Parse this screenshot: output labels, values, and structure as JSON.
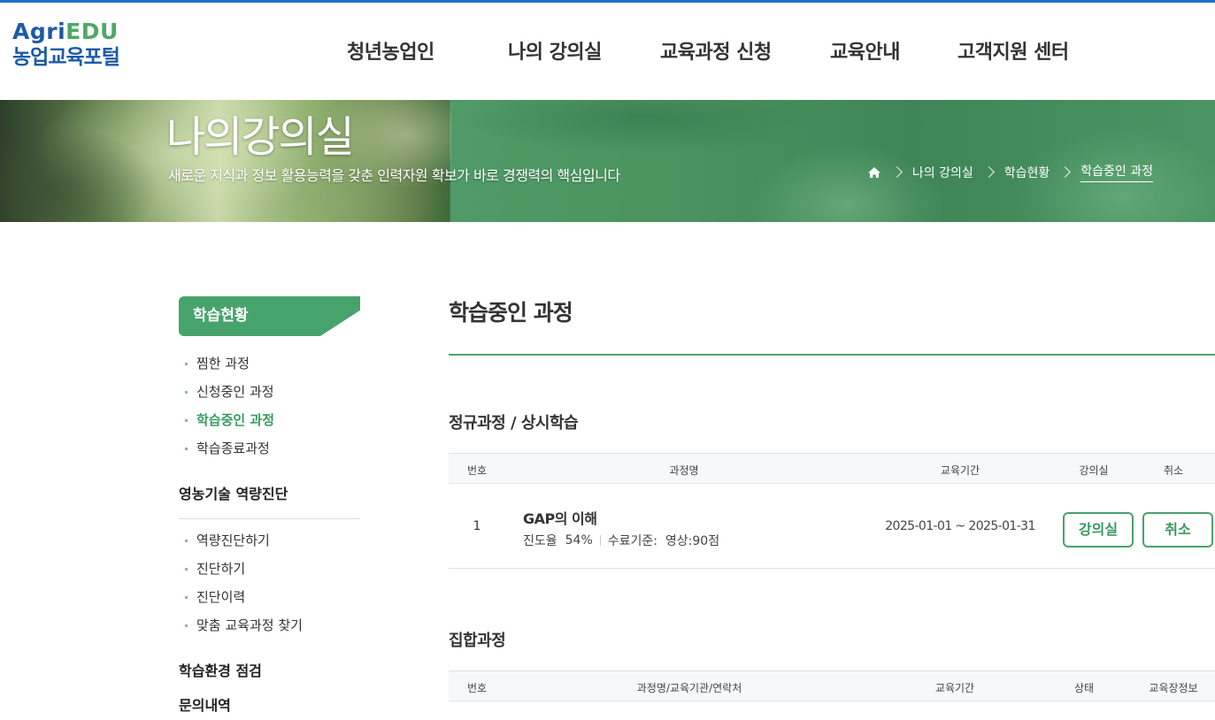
{
  "header": {
    "logo_en_agri": "Agri",
    "logo_en_edu": "EDU",
    "logo_ko": "농업교육포털",
    "nav": [
      "청년농업인",
      "나의 강의실",
      "교육과정 신청",
      "교육안내",
      "고객지원 센터"
    ]
  },
  "banner": {
    "title": "나의강의실",
    "subtitle": "새로운 지식과 정보 활용능력을 갖춘 인력자원 확보가 바로 경쟁력의 핵심입니다",
    "breadcrumb": [
      "나의 강의실",
      "학습현황",
      "학습중인 과정"
    ]
  },
  "sidebar": {
    "head": "학습현황",
    "items1": [
      "찜한 과정",
      "신청중인 과정",
      "학습중인 과정",
      "학습종료과정"
    ],
    "group2": "영농기술 역량진단",
    "items2": [
      "역량진단하기",
      "진단하기",
      "진단이력",
      "맞춤 교육과정 찾기"
    ],
    "group3": "학습환경 점검",
    "group4": "문의내역"
  },
  "main": {
    "title": "학습중인 과정",
    "section1": {
      "title": "정규과정 / 상시학습",
      "columns": [
        "번호",
        "과정명",
        "교육기간",
        "강의실",
        "취소"
      ],
      "rows": [
        {
          "no": "1",
          "name": "GAP의 이해",
          "progress_label": "진도율",
          "progress": "54%",
          "criteria": "수료기준:  영상:90점",
          "period": "2025-01-01 ~ 2025-01-31",
          "btn_room": "강의실",
          "btn_cancel": "취소"
        }
      ]
    },
    "section2": {
      "title": "집합과정",
      "columns": [
        "번호",
        "과정명/교육기관/연락처",
        "교육기간",
        "상태",
        "교육장정보"
      ]
    }
  },
  "colors": {
    "accent": "#47a36c",
    "brand": "#1d5aa8",
    "topline": "#1e6fc7"
  }
}
